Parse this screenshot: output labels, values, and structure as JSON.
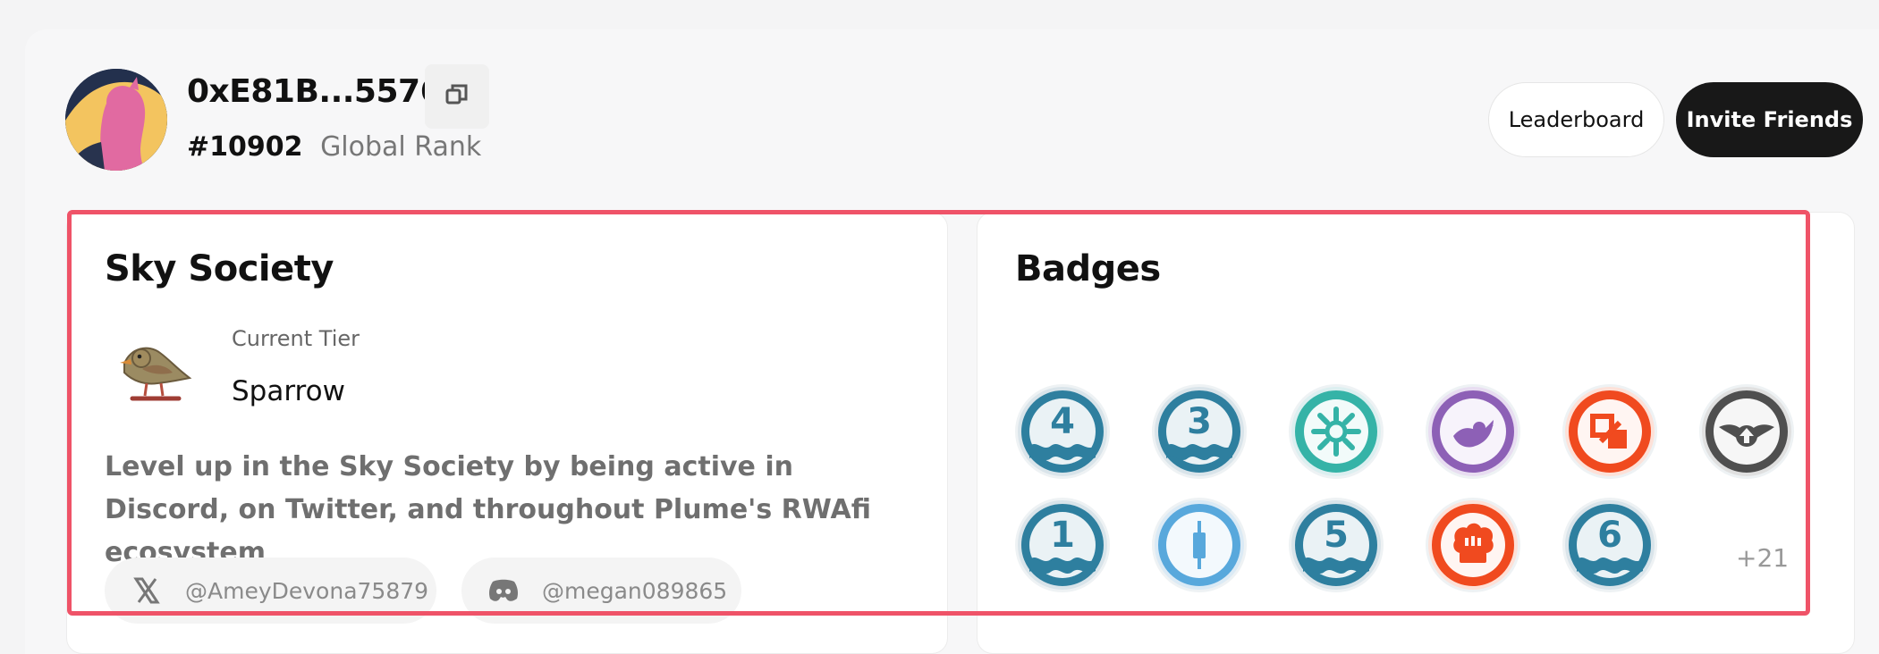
{
  "profile": {
    "wallet_address": "0xE81B...5576",
    "rank_number": "#10902",
    "rank_label": "Global Rank"
  },
  "actions": {
    "leaderboard_label": "Leaderboard",
    "invite_label": "Invite Friends"
  },
  "sky_society": {
    "title": "Sky Society",
    "tier_caption": "Current Tier",
    "tier_name": "Sparrow",
    "description": "Level up in the Sky Society by being active in Discord, on Twitter, and throughout Plume's RWAfi ecosystem",
    "socials": [
      {
        "platform_icon": "x-icon",
        "handle": "@AmeyDevona75879"
      },
      {
        "platform_icon": "discord-icon",
        "handle": "@megan089865"
      }
    ]
  },
  "badges": {
    "title": "Badges",
    "more_count": "+21",
    "items": [
      {
        "icon": "wave-4-badge",
        "label": "4",
        "color": "#2e7f9f"
      },
      {
        "icon": "wave-3-badge",
        "label": "3",
        "color": "#2e7f9f"
      },
      {
        "icon": "sun-badge",
        "color": "#35b3a7"
      },
      {
        "icon": "bird-badge",
        "color": "#8d60b6"
      },
      {
        "icon": "boxes-badge",
        "color": "#f04a1f"
      },
      {
        "icon": "winged-badge",
        "color": "#4f4f4f"
      },
      {
        "icon": "wave-1-badge",
        "label": "1",
        "color": "#2e7f9f"
      },
      {
        "icon": "candle-badge",
        "color": "#58a8dc"
      },
      {
        "icon": "wave-5-badge",
        "label": "5",
        "color": "#2e7f9f"
      },
      {
        "icon": "chef-badge",
        "color": "#f04a1f"
      },
      {
        "icon": "wave-6-badge",
        "label": "6",
        "color": "#2e7f9f"
      }
    ]
  }
}
